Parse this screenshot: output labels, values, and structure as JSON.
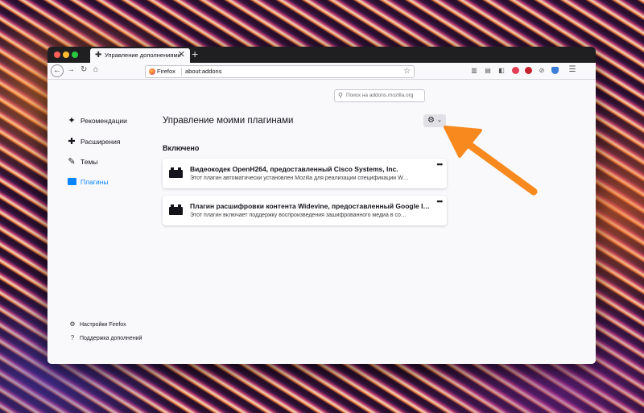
{
  "window": {
    "tab": {
      "icon": "puzzle-icon",
      "title": "Управление дополнениями",
      "close": "✕"
    },
    "new_tab": "+"
  },
  "toolbar": {
    "url_identity": "Firefox",
    "url": "about:addons",
    "icons": [
      "library-icon",
      "sidebar-icon",
      "reader-icon",
      "pocket-icon",
      "adblock-icon",
      "block-icon",
      "shield-icon",
      "menu-icon"
    ]
  },
  "search": {
    "placeholder": "Поиск на addons.mozilla.org"
  },
  "sidebar": {
    "items": [
      {
        "label": "Рекомендации",
        "icon": "sparkle-icon",
        "active": false
      },
      {
        "label": "Расширения",
        "icon": "puzzle-icon",
        "active": false
      },
      {
        "label": "Темы",
        "icon": "brush-icon",
        "active": false
      },
      {
        "label": "Плагины",
        "icon": "plugin-icon",
        "active": true
      }
    ],
    "footer": [
      {
        "label": "Настройки Firefox",
        "icon": "gear-icon"
      },
      {
        "label": "Поддержка дополнений",
        "icon": "help-icon"
      }
    ]
  },
  "main": {
    "title": "Управление моими плагинами",
    "section_heading": "Включено",
    "plugins": [
      {
        "name": "Видеокодек OpenH264, предоставленный Cisco Systems, Inc.",
        "description": "Этот плагин автоматически установлен Mozilla для реализации спецификации W…"
      },
      {
        "name": "Плагин расшифровки контента Widevine, предоставленный Google I…",
        "description": "Этот плагин включает поддержку воспроизведения зашифрованного медиа в со…"
      }
    ]
  },
  "colors": {
    "accent": "#0a84ff",
    "arrow": "#f7891f",
    "tab_bar": "#1f1f22"
  }
}
